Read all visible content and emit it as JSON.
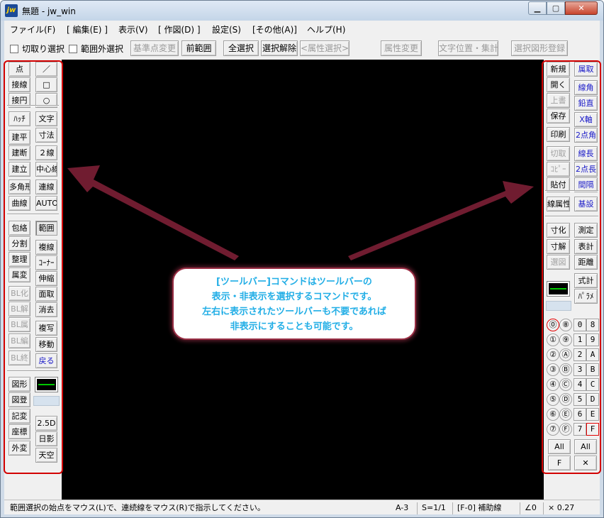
{
  "window": {
    "title": "無題 - jw_win",
    "app_icon_text": "jw",
    "min_glyph": "▁",
    "max_glyph": "▢",
    "close_glyph": "✕"
  },
  "menu": [
    "ファイル(F)",
    "[ 編集(E) ]",
    "表示(V)",
    "[ 作図(D) ]",
    "設定(S)",
    "[その他(A)]",
    "ヘルプ(H)"
  ],
  "toolbar": {
    "checkboxes": [
      "切取り選択",
      "範囲外選択"
    ],
    "buttons": [
      "基準点変更",
      "前範囲",
      "全選択",
      "選択解除",
      "<属性選択>",
      "属性変更",
      "文字位置・集計",
      "選択図形登録"
    ]
  },
  "left_panel": {
    "col1": [
      "点",
      "接線",
      "接円",
      "ﾊｯﾁ",
      "建平",
      "建断",
      "建立",
      "多角形",
      "曲線",
      "包絡",
      "分割",
      "整理",
      "属変",
      "BL化",
      "BL解",
      "BL属",
      "BL編",
      "BL終",
      "図形",
      "図登",
      "記変",
      "座標",
      "外変"
    ],
    "col2": [
      "／",
      "□",
      "○",
      "文字",
      "寸法",
      "２線",
      "中心線",
      "連線",
      "AUTO",
      "範囲",
      "複線",
      "ｺｰﾅｰ",
      "伸縮",
      "面取",
      "消去",
      "複写",
      "移動",
      "戻る",
      "2.5D",
      "日影",
      "天空"
    ]
  },
  "right_panel": {
    "col1": [
      "新規",
      "開く",
      "上書",
      "保存",
      "印刷",
      "切取",
      "ｺﾋﾟｰ",
      "貼付",
      "線属性",
      "寸化",
      "寸解",
      "選図"
    ],
    "col2": [
      "属取",
      "線角",
      "鉛直",
      "X軸",
      "2点角",
      "線長",
      "2点長",
      "間隔",
      "基設",
      "測定",
      "表計",
      "距離",
      "式計",
      "ﾊﾟﾗﾒ"
    ],
    "layer_groups": [
      "0",
      "1",
      "2",
      "3",
      "4",
      "5",
      "6",
      "7",
      "8",
      "9",
      "A",
      "B",
      "C",
      "D",
      "E",
      "F"
    ],
    "layer_groups_circled": [
      "⓪",
      "①",
      "②",
      "③",
      "④",
      "⑤",
      "⑥",
      "⑦",
      "⑧",
      "⑨",
      "Ⓐ",
      "Ⓑ",
      "Ⓒ",
      "Ⓓ",
      "Ⓔ",
      "Ⓕ"
    ],
    "all_label": "All",
    "f_label": "F",
    "x_label": "✕"
  },
  "callout": {
    "lines": [
      "[ツールバー]コマンドはツールバーの",
      "表示・非表示を選択するコマンドです。",
      "左右に表示されたツールバーも不要であれば",
      "非表示にすることも可能です。"
    ]
  },
  "status": {
    "message": "範囲選択の始点をマウス(L)で、連続線をマウス(R)で指示してください。",
    "paper": "A-3",
    "scale": "S=1/1",
    "layer": "[F-0] 補助線",
    "angle": "∠0",
    "factor": "× 0.27"
  },
  "colors": {
    "highlight_outline": "#d20000",
    "arrow": "#7a1e34",
    "callout_text": "#22aee6",
    "canvas": "#000000"
  }
}
